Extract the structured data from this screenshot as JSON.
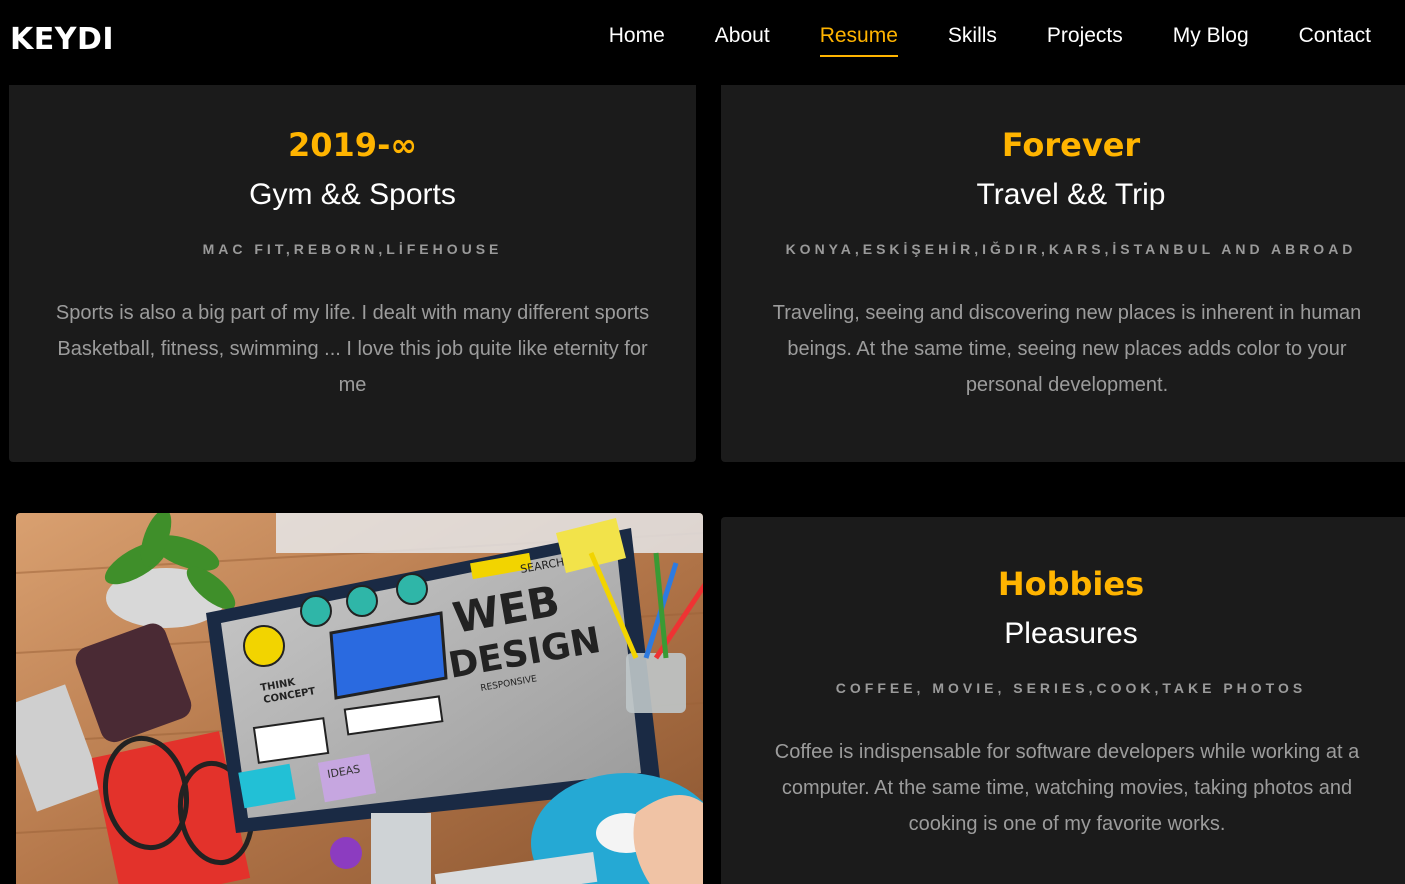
{
  "brand": "KEYDI",
  "nav": {
    "items": [
      "Home",
      "About",
      "Resume",
      "Skills",
      "Projects",
      "My Blog",
      "Contact"
    ],
    "active": "Resume"
  },
  "cards": [
    {
      "period": "2019-∞",
      "title": "Gym && Sports",
      "subtitle": "MAC FIT,REBORN,LİFEHOUSE",
      "description": "Sports is also a big part of my life. I dealt with many different sports Basketball, fitness, swimming ... I love this job quite like eternity for me"
    },
    {
      "period": "Forever",
      "title": "Travel && Trip",
      "subtitle": "KONYA,ESKİŞEHİR,IĞDIR,KARS,İSTANBUL AND ABROAD",
      "description": "Traveling, seeing and discovering new places is inherent in human beings. At the same time, seeing new places adds color to your personal development."
    },
    {
      "period": "Hobbies",
      "title": "Pleasures",
      "subtitle": "COFFEE, MOVIE, SERIES,COOK,TAKE PHOTOS",
      "description": "Coffee is indispensable for software developers while working at a computer. At the same time, watching movies, taking photos and cooking is one of my favorite works."
    }
  ],
  "image": {
    "screen_text": [
      "WEB",
      "DESIGN",
      "SEARCH",
      "THINK",
      "CONCEPT",
      "RESPONSIVE",
      "IDEAS"
    ]
  },
  "colors": {
    "accent": "#ffb400",
    "background": "#000000",
    "card": "#1b1b1b",
    "muted_text": "#9c9c9c"
  }
}
